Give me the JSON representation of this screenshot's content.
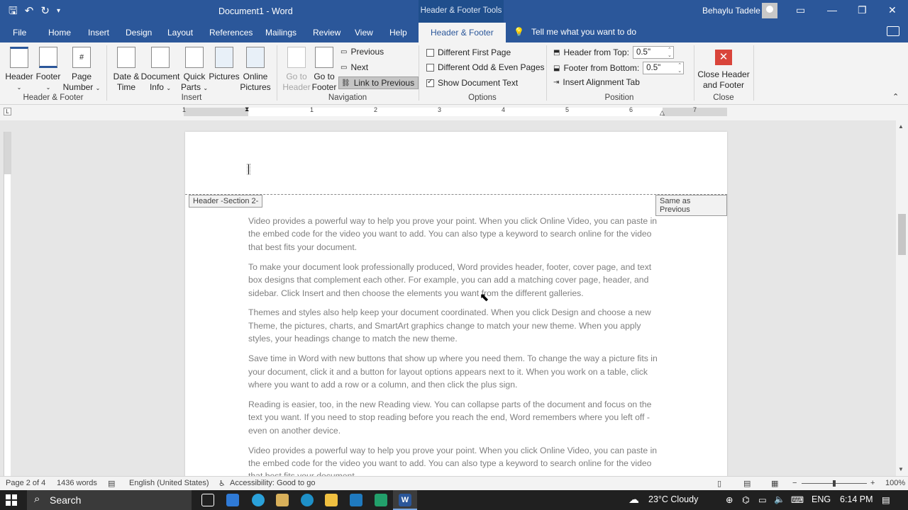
{
  "titlebar": {
    "doc_title": "Document1  -  Word",
    "tools_label": "Header & Footer Tools",
    "user_name": "Behaylu Tadele",
    "qat_icons": [
      "save-icon",
      "undo-icon",
      "redo-icon",
      "customize-icon"
    ]
  },
  "tabs": {
    "file": "File",
    "home": "Home",
    "insert": "Insert",
    "design": "Design",
    "layout": "Layout",
    "references": "References",
    "mailings": "Mailings",
    "review": "Review",
    "view": "View",
    "help": "Help",
    "header_footer": "Header & Footer",
    "tell_me": "Tell me what you want to do"
  },
  "ribbon": {
    "header_btn": "Header",
    "footer_btn": "Footer",
    "page_number_1": "Page",
    "page_number_2": "Number",
    "group_hf": "Header & Footer",
    "date_time_1": "Date &",
    "date_time_2": "Time",
    "doc_info_1": "Document",
    "doc_info_2": "Info",
    "quick_parts_1": "Quick",
    "quick_parts_2": "Parts",
    "pictures": "Pictures",
    "online_pictures_1": "Online",
    "online_pictures_2": "Pictures",
    "group_insert": "Insert",
    "go_to_header_1": "Go to",
    "go_to_header_2": "Header",
    "go_to_footer_1": "Go to",
    "go_to_footer_2": "Footer",
    "previous": "Previous",
    "next": "Next",
    "link_to_previous": "Link to Previous",
    "group_navigation": "Navigation",
    "diff_first_page": "Different First Page",
    "diff_odd_even": "Different Odd & Even Pages",
    "show_doc_text": "Show Document Text",
    "group_options": "Options",
    "header_from_top_label": "Header from Top:",
    "header_from_top_value": "0.5\"",
    "footer_from_bottom_label": "Footer from Bottom:",
    "footer_from_bottom_value": "0.5\"",
    "insert_alignment_tab": "Insert Alignment Tab",
    "group_position": "Position",
    "close_1": "Close Header",
    "close_2": "and Footer",
    "group_close": "Close"
  },
  "options_state": {
    "diff_first_page": false,
    "diff_odd_even": false,
    "show_doc_text": true
  },
  "ruler": {
    "numbers": [
      "1",
      "1",
      "2",
      "3",
      "4",
      "5",
      "6",
      "7"
    ]
  },
  "document": {
    "header_tag": "Header -Section 2-",
    "same_as_previous": "Same as Previous",
    "paragraphs": [
      "Video provides a powerful way to help you prove your point. When you click Online Video, you can paste in the embed code for the video you want to add. You can also type a keyword to search online for the video that best fits your document.",
      "To make your document look professionally produced, Word provides header, footer, cover page, and text box designs that complement each other. For example, you can add a matching cover page, header, and sidebar. Click Insert and then choose the elements you want from the different galleries.",
      "Themes and styles also help keep your document coordinated. When you click Design and choose a new Theme, the pictures, charts, and SmartArt graphics change to match your new theme. When you apply styles, your headings change to match the new theme.",
      "Save time in Word with new buttons that show up where you need them. To change the way a picture fits in your document, click it and a button for layout options appears next to it. When you work on a table, click where you want to add a row or a column, and then click the plus sign.",
      "Reading is easier, too, in the new Reading view. You can collapse parts of the document and focus on the text you want. If you need to stop reading before you reach the end, Word remembers where you left off - even on another device.",
      "Video provides a powerful way to help you prove your point. When you click Online Video, you can paste in the embed code for the video you want to add. You can also type a keyword to search online for the video that best fits your document."
    ]
  },
  "status": {
    "page": "Page 2 of 4",
    "words": "1436 words",
    "language": "English (United States)",
    "accessibility": "Accessibility: Good to go",
    "zoom": "100%"
  },
  "taskbar": {
    "search": "Search",
    "weather": "23°C  Cloudy",
    "lang": "ENG",
    "time": "6:14 PM"
  },
  "colors": {
    "accent": "#2b579a",
    "close_red": "#d9443a"
  }
}
